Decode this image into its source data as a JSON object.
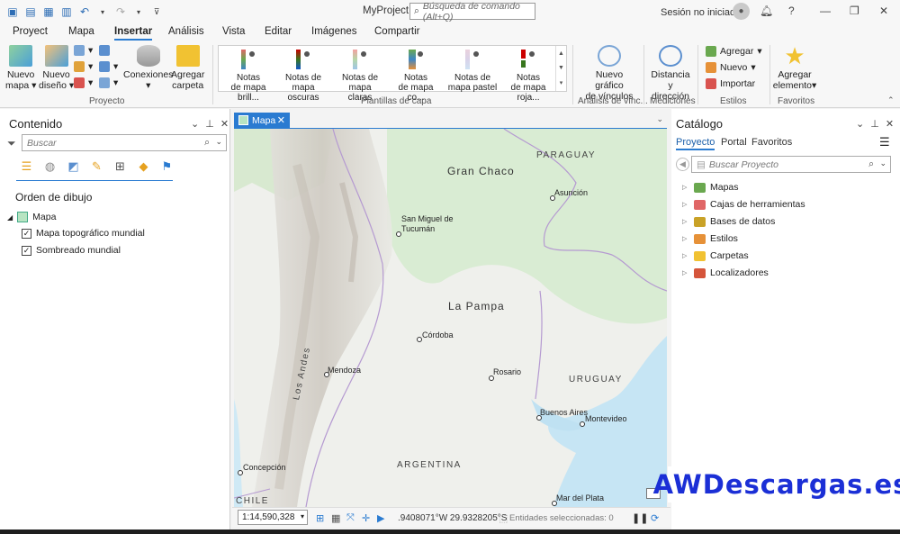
{
  "app": {
    "title": "MyProject",
    "command_search_placeholder": "Búsqueda de comando (Alt+Q)",
    "signin_text": "Sesión no iniciada",
    "help": "?"
  },
  "ribbon_tabs": [
    "Proyect",
    "Mapa",
    "Insertar",
    "Análisis",
    "Vista",
    "Editar",
    "Imágenes",
    "Compartir"
  ],
  "ribbon": {
    "project_group": {
      "label": "Proyecto",
      "new_map": [
        "Nuevo",
        "mapa"
      ],
      "new_layout": [
        "Nuevo",
        "diseño"
      ],
      "connections": "Conexiones",
      "add_folder": [
        "Agregar",
        "carpeta"
      ]
    },
    "layer_templates": {
      "label": "Plantillas de capa",
      "items": [
        [
          "Notas",
          "de mapa brill..."
        ],
        [
          "Notas de",
          "mapa oscuras"
        ],
        [
          "Notas de",
          "mapa claras"
        ],
        [
          "Notas",
          "de mapa co..."
        ],
        [
          "Notas de",
          "mapa pastel"
        ],
        [
          "Notas",
          "de mapa roja..."
        ]
      ]
    },
    "link_analysis": {
      "label": "Análisis de vínc...",
      "new_link_chart": [
        "Nuevo gráfico",
        "de vínculos"
      ]
    },
    "measurements": {
      "label": "Mediciones",
      "distance": [
        "Distancia y",
        "dirección"
      ]
    },
    "styles": {
      "label": "Estilos",
      "add": "Agregar",
      "new": "Nuevo",
      "import": "Importar"
    },
    "favorites": {
      "label": "Favoritos",
      "add_item": [
        "Agregar",
        "elemento"
      ]
    }
  },
  "contents": {
    "title": "Contenido",
    "search_placeholder": "Buscar",
    "drawing_order": "Orden de dibujo",
    "map_name": "Mapa",
    "layers": [
      {
        "name": "Mapa topográfico mundial",
        "checked": true
      },
      {
        "name": "Sombreado mundial",
        "checked": true
      }
    ]
  },
  "map_view": {
    "tab_label": "Mapa",
    "labels": {
      "paraguay": "PARAGUAY",
      "gran_chaco": "Gran Chaco",
      "asuncion": "Asunción",
      "san_miguel_1": "San Miguel de",
      "san_miguel_2": "Tucumán",
      "la_pampa": "La Pampa",
      "cordoba": "Córdoba",
      "mendoza": "Mendoza",
      "los_andes": "Los Andes",
      "rosario": "Rosario",
      "uruguay": "URUGUAY",
      "buenos_aires": "Buenos Aires",
      "montevideo": "Montevideo",
      "argentina": "ARGENTINA",
      "concepcion": "Concepción",
      "chile": "CHILE",
      "mar_del_plata": "Mar del Plata"
    },
    "scale": "1:14,590,328",
    "coordinates": ".9408071°W 29.9328205°S",
    "selected_features": "Entidades seleccionadas: 0"
  },
  "catalog": {
    "title": "Catálogo",
    "tabs": [
      "Proyecto",
      "Portal",
      "Favoritos"
    ],
    "search_placeholder": "Buscar Proyecto",
    "items": [
      {
        "label": "Mapas",
        "color": "#6aa84f"
      },
      {
        "label": "Cajas de herramientas",
        "color": "#e06666"
      },
      {
        "label": "Bases de datos",
        "color": "#c9a227"
      },
      {
        "label": "Estilos",
        "color": "#e69138"
      },
      {
        "label": "Carpetas",
        "color": "#f1c232"
      },
      {
        "label": "Localizadores",
        "color": "#d5553b"
      }
    ]
  },
  "watermark": "AWDescargas.es",
  "colors": {
    "accent": "#2a7bd1",
    "land": "#eef0ea",
    "water": "#c9e6f3",
    "green": "#d7ecd2"
  }
}
